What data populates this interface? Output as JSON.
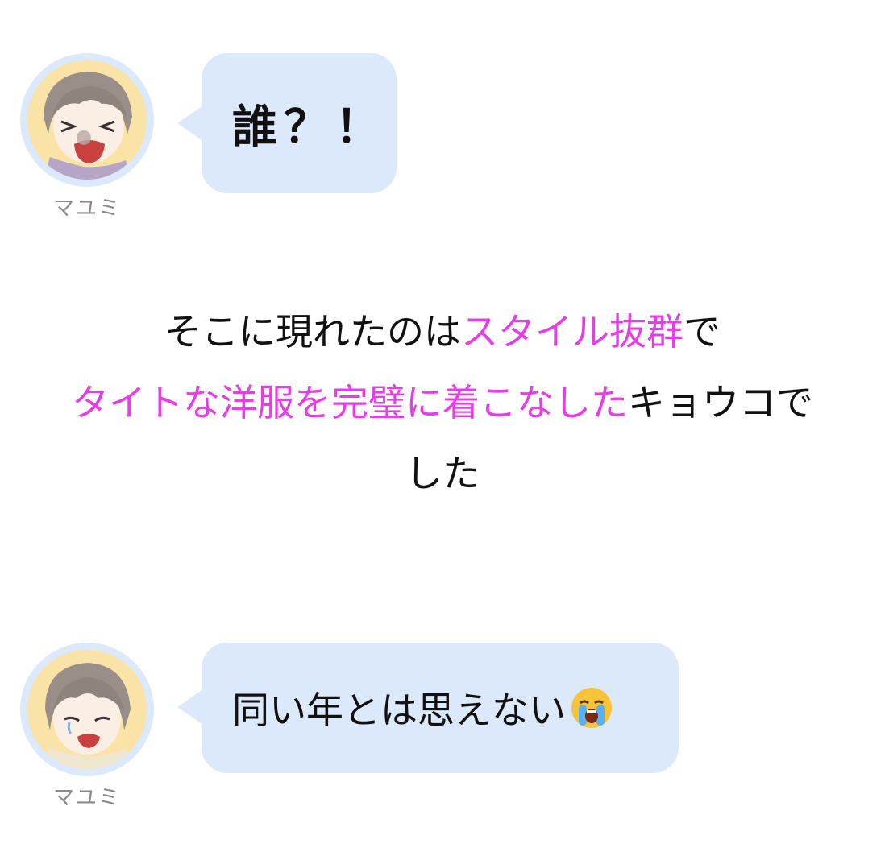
{
  "messages": [
    {
      "speaker": "マユミ",
      "text": "誰？！",
      "avatar_icon": "shouting-character-avatar"
    },
    {
      "speaker": "マユミ",
      "text": "同い年とは思えない",
      "emoji": "loudly-crying-face-icon",
      "avatar_icon": "crying-character-avatar"
    }
  ],
  "narration": {
    "line1_a": "そこに現れたのは",
    "line1_b": "スタイル抜群",
    "line1_c": "で",
    "line2_a": "タイトな洋服を完璧に着こなした",
    "line2_b": "キョウコで",
    "line3": "した"
  },
  "colors": {
    "bubble": "#dbe9fb",
    "highlight": "#e53ee6",
    "speaker_name": "#8a8a8a"
  }
}
